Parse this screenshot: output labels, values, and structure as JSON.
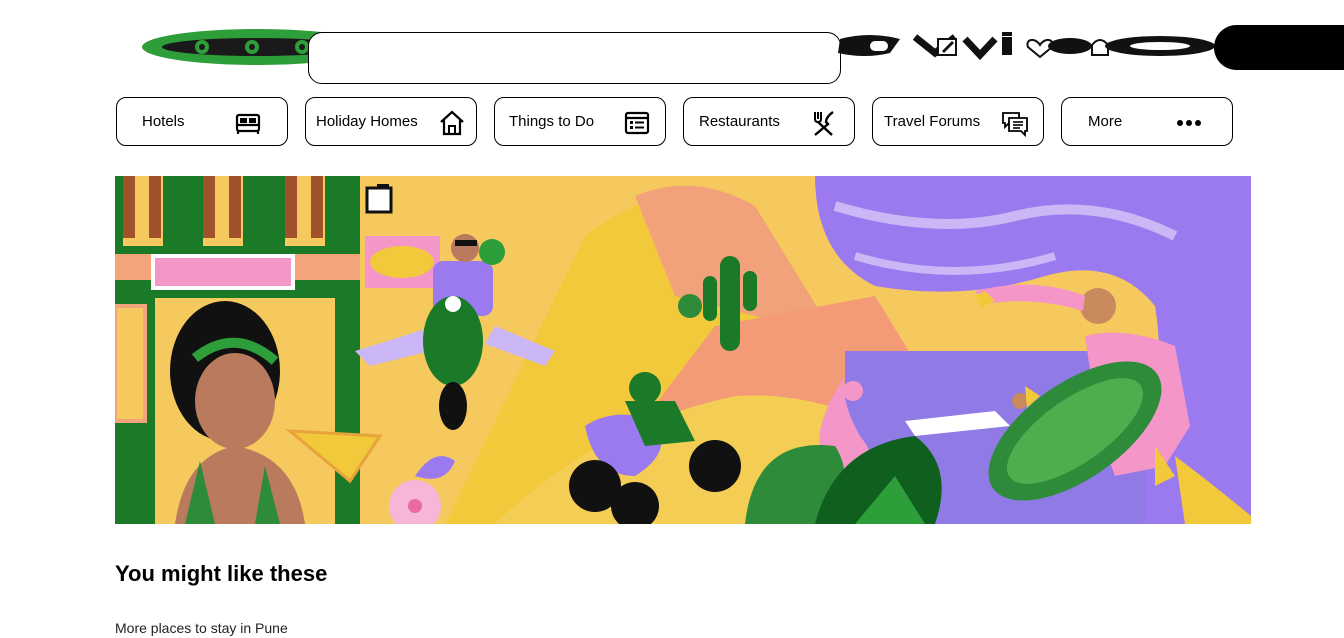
{
  "header": {
    "search_placeholder": "",
    "search_value": "",
    "brand_color": "#34a853"
  },
  "nav": {
    "items": [
      {
        "label": "Hotels",
        "icon": "bed-icon"
      },
      {
        "label": "Holiday Homes",
        "icon": "house-icon"
      },
      {
        "label": "Things to Do",
        "icon": "ticket-list-icon"
      },
      {
        "label": "Restaurants",
        "icon": "fork-knife-icon"
      },
      {
        "label": "Travel Forums",
        "icon": "chat-bubbles-icon"
      },
      {
        "label": "More",
        "icon": "more-dots-icon"
      }
    ]
  },
  "hero": {
    "image": "travel-illustration"
  },
  "section": {
    "title": "You might like these",
    "subtitle": "More places to stay in Pune"
  }
}
